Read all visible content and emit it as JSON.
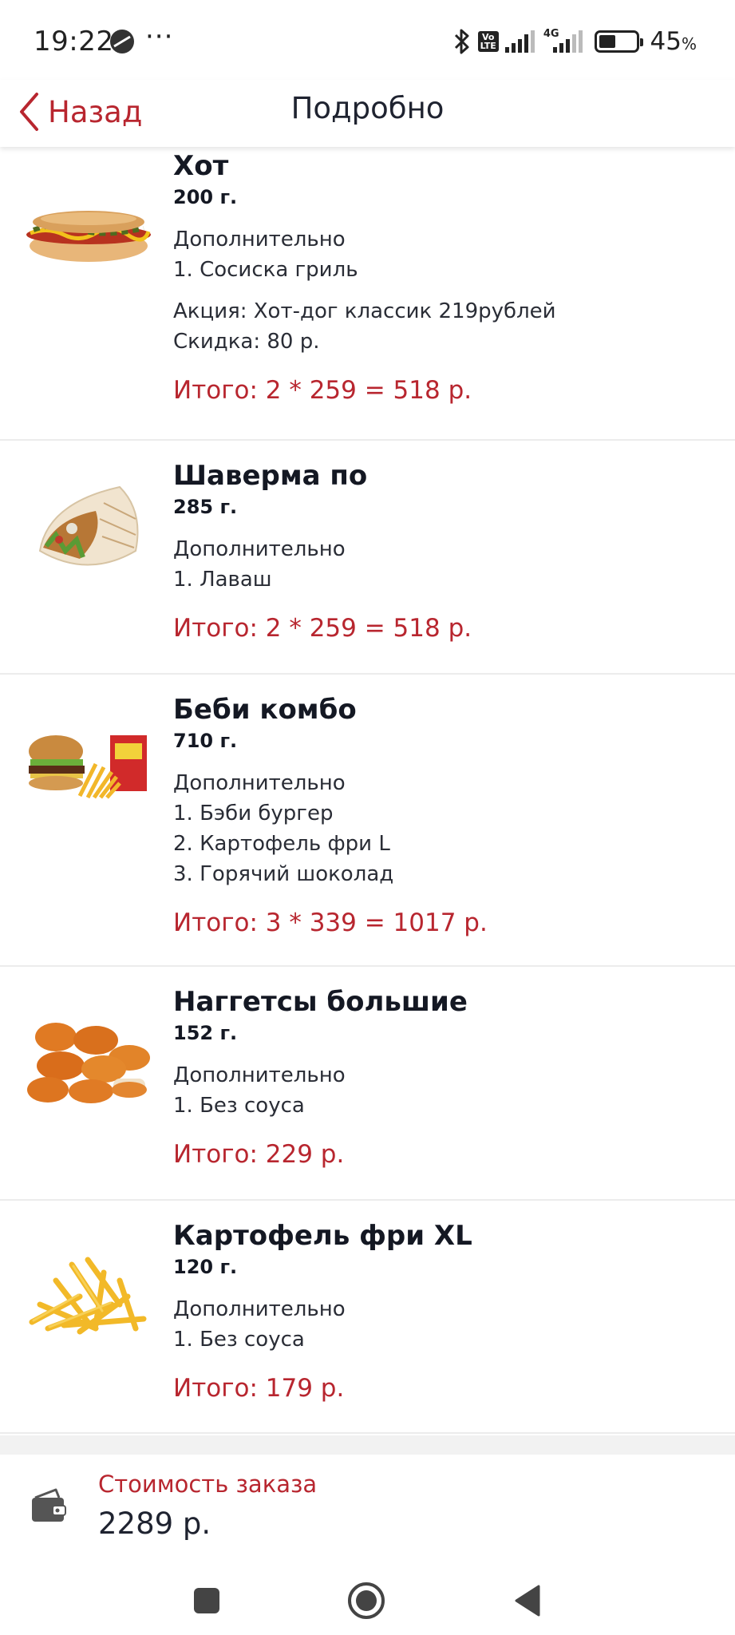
{
  "status_bar": {
    "time": "19:22",
    "more": "···",
    "network": "4G",
    "volte": "Vo LTE",
    "battery_percent": "45",
    "battery_symbol": "%",
    "battery_level": 0.45
  },
  "header": {
    "back_label": "Назад",
    "title": "Подробно"
  },
  "items": [
    {
      "name": "Хот",
      "weight": "200 г.",
      "extras_heading": "Дополнительно",
      "extras": [
        "1. Сосиска гриль"
      ],
      "promo": [
        "Акция: Хот-дог классик 219рублей",
        "Скидка: 80 р."
      ],
      "total": "Итого: 2 * 259 = 518 р.",
      "image_icon": "hot-dog-photo"
    },
    {
      "name": "Шаверма по",
      "weight": "285 г.",
      "extras_heading": "Дополнительно",
      "extras": [
        "1. Лаваш"
      ],
      "promo": [],
      "total": "Итого: 2 * 259 = 518 р.",
      "image_icon": "shawarma-photo"
    },
    {
      "name": "Беби комбо",
      "weight": "710 г.",
      "extras_heading": "Дополнительно",
      "extras": [
        "1. Бэби бургер",
        "2. Картофель фри L",
        "3. Горячий шоколад"
      ],
      "promo": [],
      "total": "Итого: 3 * 339 = 1017 р.",
      "image_icon": "combo-photo"
    },
    {
      "name": "Наггетсы большие",
      "weight": "152 г.",
      "extras_heading": "Дополнительно",
      "extras": [
        "1. Без соуса"
      ],
      "promo": [],
      "total": "Итого: 229 р.",
      "image_icon": "nuggets-photo"
    },
    {
      "name": "Картофель фри XL",
      "weight": "120 г.",
      "extras_heading": "Дополнительно",
      "extras": [
        "1. Без соуса"
      ],
      "promo": [],
      "total": "Итого: 179 р.",
      "image_icon": "fries-photo"
    }
  ],
  "footer": {
    "label": "Стоимость заказа",
    "value": "2289 р.",
    "icon": "wallet-icon"
  },
  "colors": {
    "accent": "#b8262f",
    "text": "#141823",
    "divider": "#ececec"
  }
}
